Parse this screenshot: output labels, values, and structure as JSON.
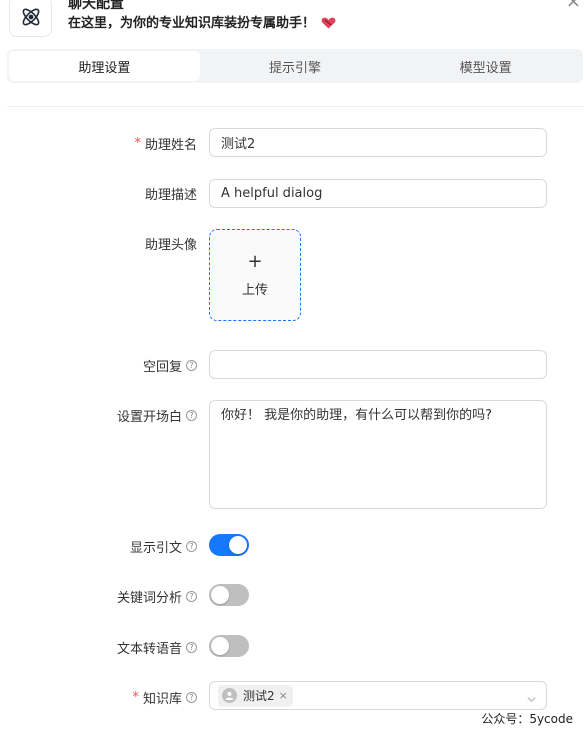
{
  "header": {
    "title": "聊天配置",
    "subtitle": "在这里，为你的专业知识库装扮专属助手！",
    "close_glyph": "×"
  },
  "tabs": [
    {
      "label": "助理设置",
      "active": true
    },
    {
      "label": "提示引擎",
      "active": false
    },
    {
      "label": "模型设置",
      "active": false
    }
  ],
  "form": {
    "name": {
      "label": "助理姓名",
      "required_mark": "*",
      "value": "测试2"
    },
    "description": {
      "label": "助理描述",
      "value": "A helpful dialog"
    },
    "avatar": {
      "label": "助理头像",
      "upload_plus": "+",
      "upload_text": "上传"
    },
    "empty_reply": {
      "label": "空回复",
      "value": ""
    },
    "opener": {
      "label": "设置开场白",
      "value": "你好！ 我是你的助理，有什么可以帮到你的吗?"
    },
    "show_quote": {
      "label": "显示引文",
      "enabled": true
    },
    "keyword_analysis": {
      "label": "关键词分析",
      "enabled": false
    },
    "tts": {
      "label": "文本转语音",
      "enabled": false
    },
    "knowledge_base": {
      "label": "知识库",
      "required_mark": "*",
      "selected": [
        "测试2"
      ],
      "tag_close": "×"
    }
  },
  "help_icon": "?",
  "colors": {
    "accent": "#1677ff",
    "required": "#ff4d4f",
    "switch_off": "#bfbfbf",
    "tab_bg": "#f2f3f5"
  },
  "watermark": "公众号：5ycode"
}
